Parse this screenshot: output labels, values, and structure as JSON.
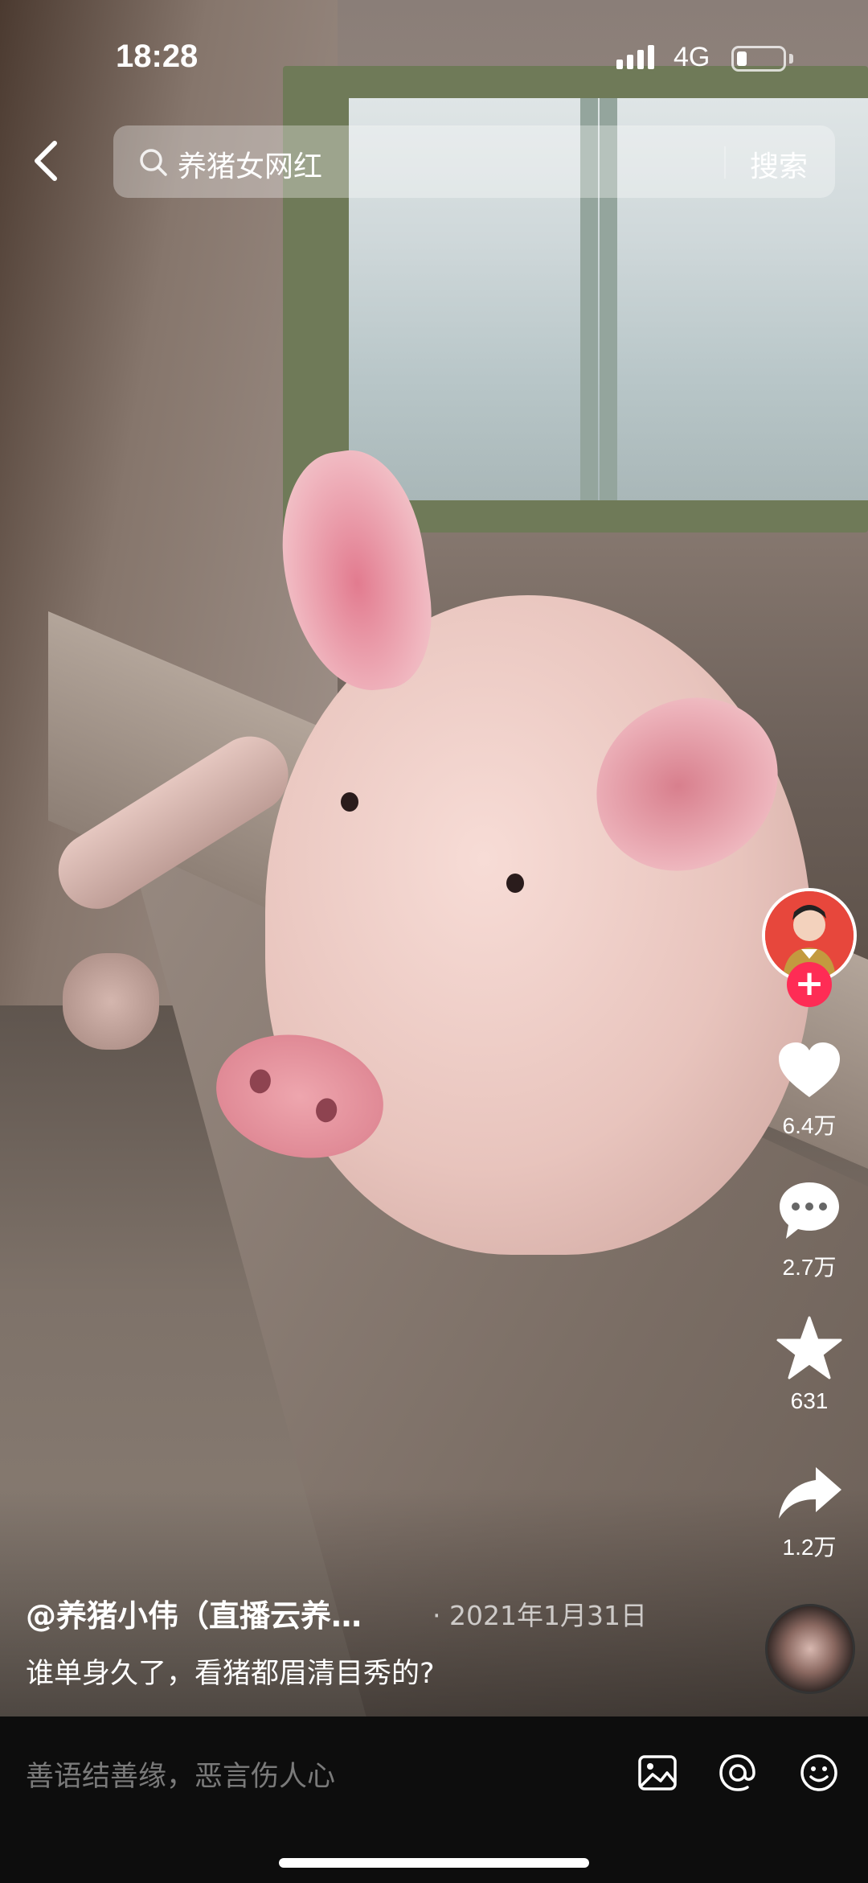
{
  "status_bar": {
    "time": "18:28",
    "network": "4G"
  },
  "search": {
    "query": "养猪女网红",
    "submit_label": "搜索"
  },
  "video": {
    "author": "@养猪小伟（直播云养…",
    "date": "· 2021年1月31日",
    "caption": "谁单身久了，看猪都眉清目秀的?"
  },
  "rail": {
    "likes": "6.4万",
    "comments": "2.7万",
    "favorites": "631",
    "shares": "1.2万"
  },
  "comment_bar": {
    "placeholder": "善语结善缘，恶言伤人心"
  },
  "icons": {
    "back": "chevron-left-icon",
    "search": "magnifier-icon",
    "like": "heart-icon",
    "comment": "speech-bubble-icon",
    "favorite": "star-icon",
    "share": "share-arrow-icon",
    "image": "image-icon",
    "mention": "at-icon",
    "emoji": "emoji-icon"
  },
  "colors": {
    "follow_accent": "#fe2c55"
  }
}
